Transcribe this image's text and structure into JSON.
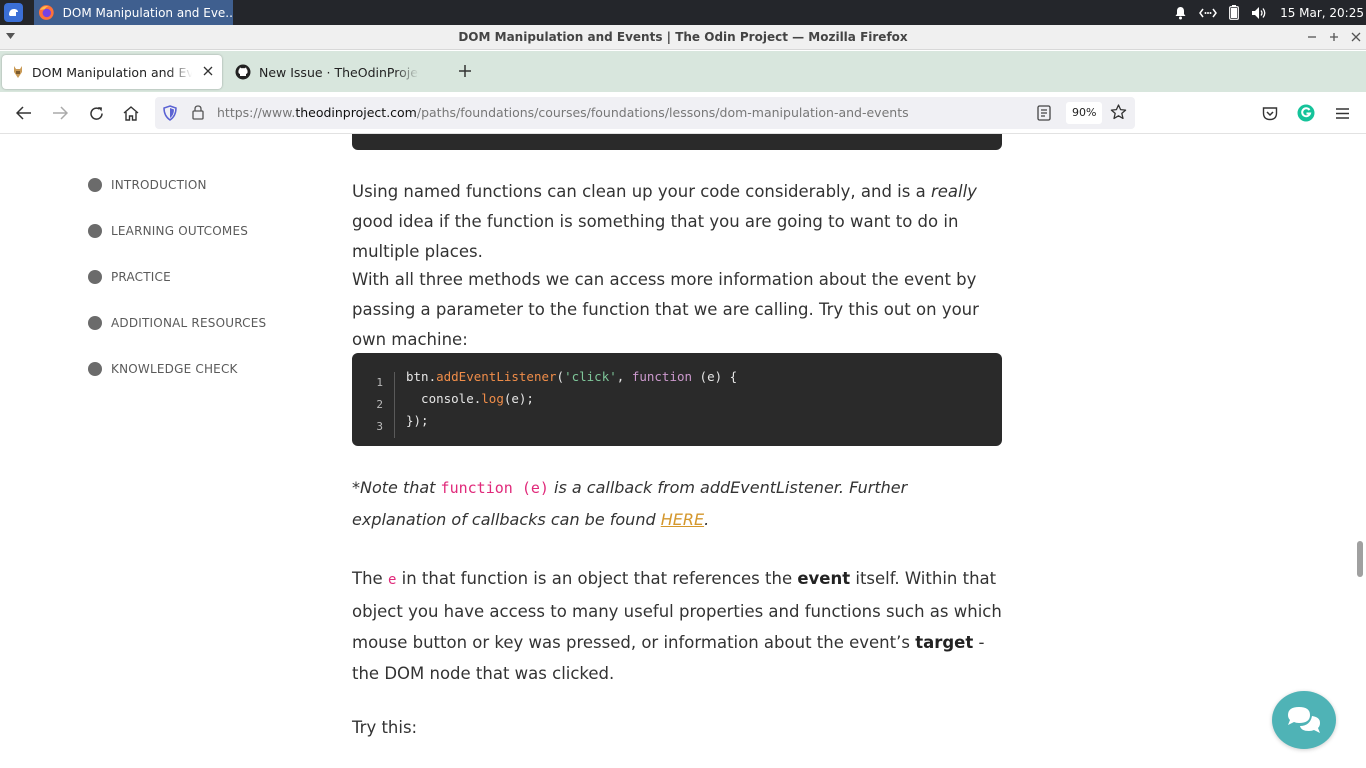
{
  "taskbar": {
    "task_label": "DOM Manipulation and Eve...",
    "clock": "15 Mar, 20:25"
  },
  "window": {
    "title": "DOM Manipulation and Events | The Odin Project — Mozilla Firefox"
  },
  "tabs": [
    {
      "title": "DOM Manipulation and Events | The Odin Project",
      "active": true
    },
    {
      "title": "New Issue · TheOdinProject/curriculum",
      "active": false
    }
  ],
  "toolbar": {
    "url_scheme": "https://www.",
    "url_host": "theodinproject.com",
    "url_path": "/paths/foundations/courses/foundations/lessons/dom-manipulation-and-events",
    "zoom": "90%"
  },
  "sidebar": {
    "items": [
      {
        "label": "INTRODUCTION"
      },
      {
        "label": "LEARNING OUTCOMES"
      },
      {
        "label": "PRACTICE"
      },
      {
        "label": "ADDITIONAL RESOURCES"
      },
      {
        "label": "KNOWLEDGE CHECK"
      }
    ]
  },
  "article": {
    "p1_a": "Using named functions can clean up your code considerably, and is a ",
    "p1_em": "really",
    "p1_b": " good idea if the function is something that you are going to want to do in multiple places.",
    "p2": "With all three methods we can access more information about the event by passing a parameter to the function that we are calling. Try this out on your own machine:",
    "code": {
      "line_numbers": [
        "1",
        "2",
        "3"
      ],
      "l1_obj": "btn.",
      "l1_fn": "addEventListener",
      "l1_p1": "(",
      "l1_str": "'click'",
      "l1_p2": ", ",
      "l1_kw": "function",
      "l1_p3": " (e) {",
      "l2_a": "  console.",
      "l2_fn": "log",
      "l2_b": "(e);",
      "l3": "});"
    },
    "note_a": "*Note that ",
    "note_code": "function (e)",
    "note_b": " is a callback from addEventListener. Further explanation of callbacks can be found ",
    "note_link": "HERE",
    "note_c": ".",
    "p3_a": "The ",
    "p3_code": "e",
    "p3_b": " in that function is an object that references the ",
    "p3_strong1": "event",
    "p3_c": " itself. Within that object you have access to many useful properties and functions such as which mouse button or key was pressed, or information about the event’s ",
    "p3_strong2": "target",
    "p3_d": " - the DOM node that was clicked.",
    "p4": "Try this:"
  }
}
